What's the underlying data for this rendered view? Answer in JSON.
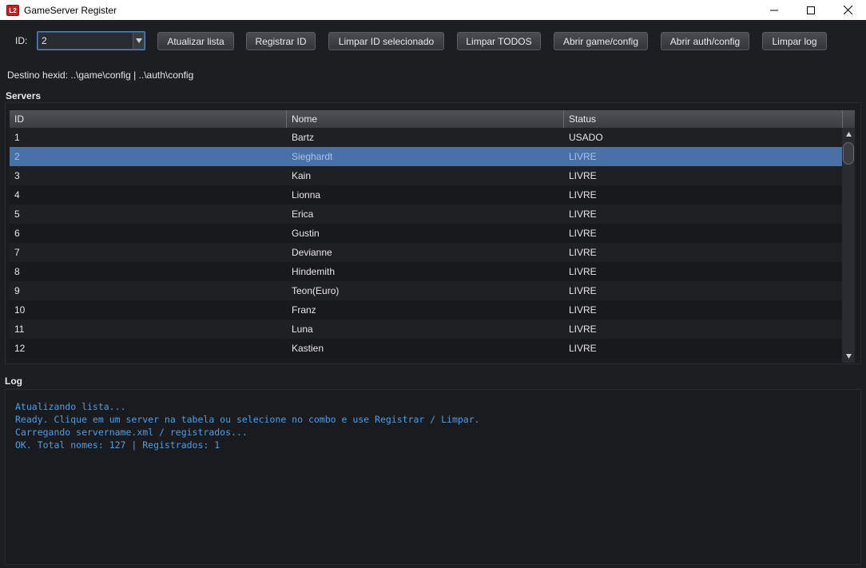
{
  "window": {
    "title": "GameServer Register",
    "icon_text": "L2",
    "controls": [
      "minimize-icon",
      "maximize-icon",
      "close-icon"
    ]
  },
  "toolbar": {
    "id_label": "ID:",
    "id_combo_value": "2",
    "buttons": {
      "refresh": "Atualizar lista",
      "register": "Registrar ID",
      "clear_selected": "Limpar ID selecionado",
      "clear_all": "Limpar TODOS",
      "open_game_config": "Abrir game/config",
      "open_auth_config": "Abrir auth/config",
      "clear_log": "Limpar log"
    }
  },
  "destination": "Destino hexid: ..\\game\\config | ..\\auth\\config",
  "servers": {
    "title": "Servers",
    "columns": [
      "ID",
      "Nome",
      "Status"
    ],
    "selected_id": "2",
    "rows": [
      {
        "id": "1",
        "name": "Bartz",
        "status": "USADO"
      },
      {
        "id": "2",
        "name": "Sieghardt",
        "status": "LIVRE"
      },
      {
        "id": "3",
        "name": "Kain",
        "status": "LIVRE"
      },
      {
        "id": "4",
        "name": "Lionna",
        "status": "LIVRE"
      },
      {
        "id": "5",
        "name": "Erica",
        "status": "LIVRE"
      },
      {
        "id": "6",
        "name": "Gustin",
        "status": "LIVRE"
      },
      {
        "id": "7",
        "name": "Devianne",
        "status": "LIVRE"
      },
      {
        "id": "8",
        "name": "Hindemith",
        "status": "LIVRE"
      },
      {
        "id": "9",
        "name": "Teon(Euro)",
        "status": "LIVRE"
      },
      {
        "id": "10",
        "name": "Franz",
        "status": "LIVRE"
      },
      {
        "id": "11",
        "name": "Luna",
        "status": "LIVRE"
      },
      {
        "id": "12",
        "name": "Kastien",
        "status": "LIVRE"
      }
    ]
  },
  "log": {
    "title": "Log",
    "lines": [
      "Atualizando lista...",
      "Ready. Clique em um server na tabela ou selecione no combo e use Registrar / Limpar.",
      "Carregando servername.xml / registrados...",
      "OK. Total nomes: 127 | Registrados: 1"
    ]
  },
  "colors": {
    "background": "#1d1e22",
    "selection": "#4a70a8",
    "log_text": "#4a9fe8"
  }
}
